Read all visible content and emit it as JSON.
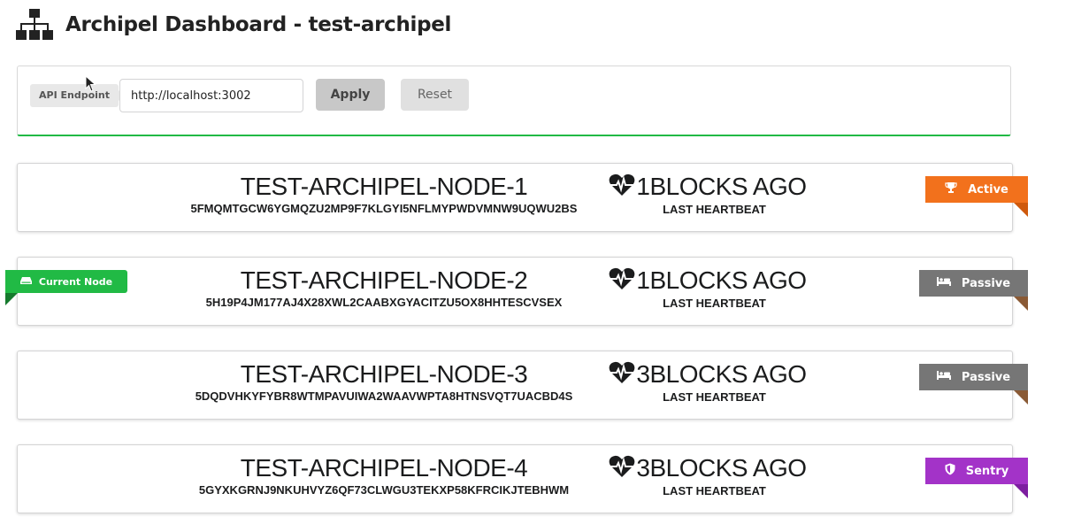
{
  "header": {
    "title": "Archipel Dashboard - test-archipel",
    "logo_icon": "sitemap-icon"
  },
  "api": {
    "label": "API Endpoint",
    "value": "http://localhost:3002",
    "apply_label": "Apply",
    "reset_label": "Reset"
  },
  "nodes": [
    {
      "name": "TEST-ARCHIPEL-NODE-1",
      "key": "5FMQMTGCW6YGMQZU2MP9F7KLGYI5NFLMYPWDVMNW9UQWU2BS",
      "heartbeat": "1BLOCKS AGO",
      "heartbeat_label": "LAST HEARTBEAT",
      "status": "Active",
      "status_icon": "trophy-icon",
      "status_color": "#f2711c",
      "current": false
    },
    {
      "name": "TEST-ARCHIPEL-NODE-2",
      "key": "5H19P4JM177AJ4X28XWL2CAABXGYACITZU5OX8HHTESCVSEX",
      "heartbeat": "1BLOCKS AGO",
      "heartbeat_label": "LAST HEARTBEAT",
      "status": "Passive",
      "status_icon": "bed-icon",
      "status_color": "#767676",
      "current": true,
      "current_label": "Current Node"
    },
    {
      "name": "TEST-ARCHIPEL-NODE-3",
      "key": "5DQDVHKYFYBR8WTMPAVUIWA2WAAVWPTA8HTNSVQT7UACBD4S",
      "heartbeat": "3BLOCKS AGO",
      "heartbeat_label": "LAST HEARTBEAT",
      "status": "Passive",
      "status_icon": "bed-icon",
      "status_color": "#767676",
      "current": false
    },
    {
      "name": "TEST-ARCHIPEL-NODE-4",
      "key": "5GYXKGRNJ9NKUHVYZ6QF73CLWGU3TEKXP58KFRCIKJTEBHWM",
      "heartbeat": "3BLOCKS AGO",
      "heartbeat_label": "LAST HEARTBEAT",
      "status": "Sentry",
      "status_icon": "shield-icon",
      "status_color": "#a333c8",
      "current": false
    }
  ]
}
